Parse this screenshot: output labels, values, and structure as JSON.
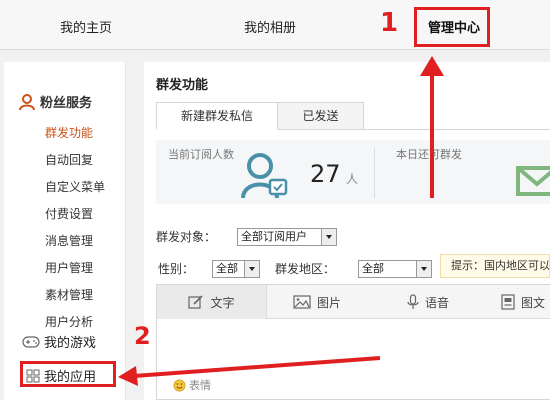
{
  "topnav": {
    "items": [
      {
        "label": "我的主页"
      },
      {
        "label": "我的相册"
      },
      {
        "label": "管理中心"
      }
    ]
  },
  "sidebar": {
    "section_title": "粉丝服务",
    "items": [
      {
        "label": "群发功能"
      },
      {
        "label": "自动回复"
      },
      {
        "label": "自定义菜单"
      },
      {
        "label": "付费设置"
      },
      {
        "label": "消息管理"
      },
      {
        "label": "用户管理"
      },
      {
        "label": "素材管理"
      },
      {
        "label": "用户分析"
      }
    ],
    "games_label": "我的游戏",
    "apps_label": "我的应用"
  },
  "main": {
    "title": "群发功能",
    "tabs": [
      {
        "label": "新建群发私信"
      },
      {
        "label": "已发送"
      }
    ],
    "stats": {
      "subscribers_label": "当前订阅人数",
      "subscribers_value": "27",
      "subscribers_unit": "人",
      "remaining_label": "本日还可群发"
    },
    "form": {
      "target_label": "群发对象：",
      "target_value": "全部订阅用户",
      "gender_label": "性别：",
      "gender_value": "全部",
      "region_label": "群发地区：",
      "region_value": "全部",
      "hint": "提示：国内地区可以"
    },
    "editor_tabs": [
      {
        "label": "文字"
      },
      {
        "label": "图片"
      },
      {
        "label": "语音"
      },
      {
        "label": "图文"
      }
    ],
    "emoji_label": "表情"
  },
  "annotations": {
    "step1": "1",
    "step2": "2"
  },
  "colors": {
    "annotation_red": "#e02020",
    "active_menu": "#c7541c",
    "avatar_teal": "#4a90a8",
    "mail_green": "#7fb77e"
  }
}
